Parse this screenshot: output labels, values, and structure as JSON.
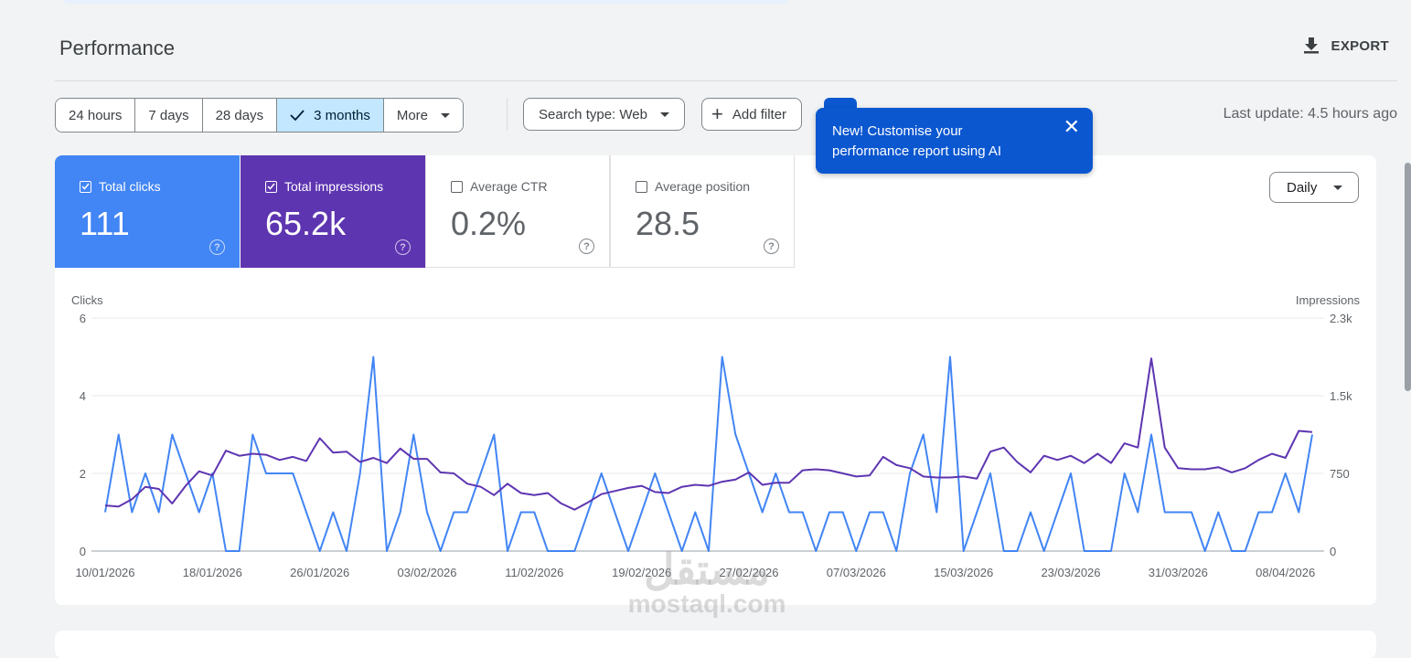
{
  "header": {
    "title": "Performance",
    "export_label": "EXPORT"
  },
  "toolbar": {
    "ranges": [
      "24 hours",
      "7 days",
      "28 days",
      "3 months",
      "More"
    ],
    "active_range": "3 months",
    "search_type": "Search type: Web",
    "add_filter": "Add filter",
    "last_update": "Last update: 4.5 hours ago"
  },
  "tooltip": {
    "text": "New! Customise your performance report using AI"
  },
  "metrics": [
    {
      "label": "Total clicks",
      "value": "111",
      "checked": true
    },
    {
      "label": "Total impressions",
      "value": "65.2k",
      "checked": true
    },
    {
      "label": "Average CTR",
      "value": "0.2%",
      "checked": false
    },
    {
      "label": "Average position",
      "value": "28.5",
      "checked": false
    }
  ],
  "granularity": "Daily",
  "watermark": {
    "line1": "مستقل",
    "line2": "mostaql.com"
  },
  "colors": {
    "clicks": "#4285f4",
    "impressions": "#5e35b1",
    "accent": "#0b57d0"
  },
  "chart_data": {
    "type": "line",
    "start_date": "10/01/2026",
    "x_tick_labels": [
      "10/01/2026",
      "18/01/2026",
      "26/01/2026",
      "03/02/2026",
      "11/02/2026",
      "19/02/2026",
      "27/02/2026",
      "07/03/2026",
      "15/03/2026",
      "23/03/2026",
      "31/03/2026",
      "08/04/2026"
    ],
    "ylabel_left": "Clicks",
    "ylabel_right": "Impressions",
    "yticks_left": [
      "0",
      "2",
      "4",
      "6"
    ],
    "yticks_right": [
      "0",
      "750",
      "1.5k",
      "2.3k"
    ],
    "ylim_left": [
      0,
      6
    ],
    "ylim_right": [
      0,
      2250
    ],
    "grid": true,
    "series": [
      {
        "name": "Clicks",
        "axis": "left",
        "color": "#4285f4",
        "values": [
          1,
          3,
          1,
          2,
          1,
          3,
          2,
          1,
          2,
          0,
          0,
          3,
          2,
          2,
          2,
          1,
          0,
          1,
          0,
          2,
          5,
          0,
          1,
          3,
          1,
          0,
          1,
          1,
          2,
          3,
          0,
          1,
          1,
          0,
          0,
          0,
          1,
          2,
          1,
          0,
          1,
          2,
          1,
          0,
          1,
          0,
          5,
          3,
          2,
          1,
          2,
          1,
          1,
          0,
          1,
          1,
          0,
          1,
          1,
          0,
          2,
          3,
          1,
          5,
          0,
          1,
          2,
          0,
          0,
          1,
          0,
          1,
          2,
          0,
          0,
          0,
          2,
          1,
          3,
          1,
          1,
          1,
          0,
          1,
          0,
          0,
          1,
          1,
          2,
          1,
          3
        ]
      },
      {
        "name": "Impressions",
        "axis": "right",
        "color": "#5e35b1",
        "values": [
          440,
          430,
          500,
          620,
          600,
          460,
          630,
          770,
          730,
          970,
          920,
          940,
          930,
          880,
          910,
          870,
          1090,
          950,
          960,
          860,
          900,
          850,
          990,
          890,
          890,
          760,
          750,
          650,
          620,
          540,
          650,
          560,
          540,
          560,
          460,
          400,
          470,
          550,
          580,
          610,
          630,
          570,
          560,
          620,
          640,
          630,
          670,
          690,
          760,
          640,
          660,
          660,
          780,
          790,
          780,
          750,
          720,
          730,
          910,
          830,
          800,
          720,
          710,
          710,
          720,
          700,
          960,
          1000,
          860,
          760,
          920,
          880,
          920,
          850,
          940,
          850,
          1040,
          1000,
          1860,
          1000,
          800,
          790,
          790,
          810,
          760,
          800,
          880,
          940,
          900,
          1160,
          1150
        ]
      }
    ]
  }
}
